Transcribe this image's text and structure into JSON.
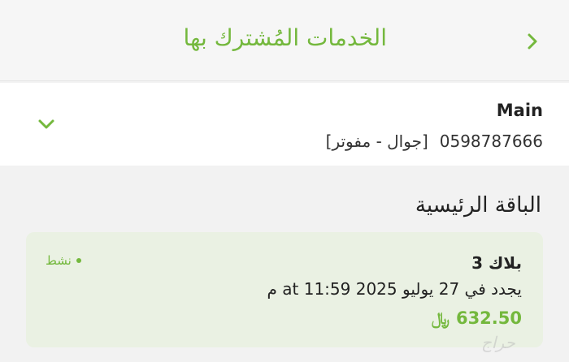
{
  "header": {
    "title": "الخدمات المُشترك بها",
    "back_icon": "chevron-right-icon"
  },
  "account": {
    "name": "Main",
    "number": "0598787666",
    "type": "[جوال - مفوتر]",
    "expand_icon": "chevron-down-icon"
  },
  "section": {
    "title": "الباقة الرئيسية"
  },
  "plan": {
    "name": "بلاك 3",
    "renewal": "يجدد في 27 يوليو 2025 at 11:59 م",
    "price": "632.50",
    "currency_icon": "saudi-riyal-icon",
    "status": "نشط"
  },
  "watermark": {
    "text": "حراج"
  },
  "colors": {
    "accent": "#74b83d",
    "card_bg": "#eaf1e3",
    "page_bg": "#f2f2f2"
  }
}
